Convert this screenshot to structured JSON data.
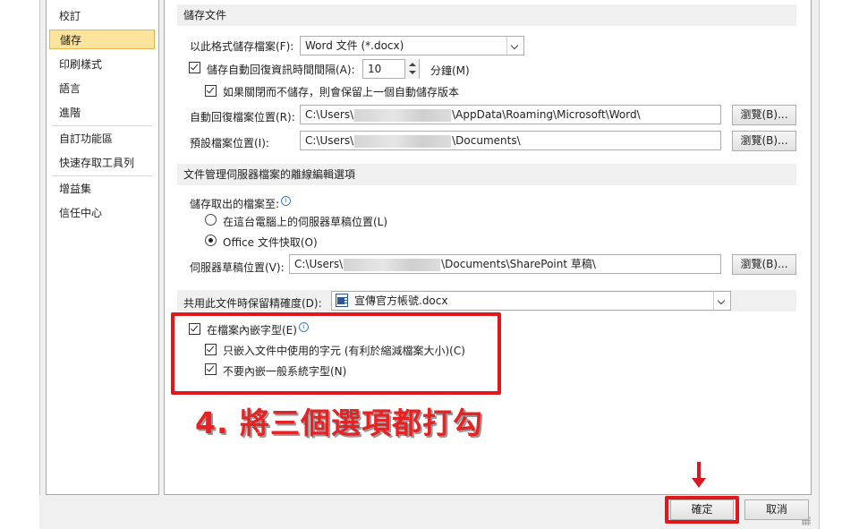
{
  "sidebar": {
    "items": [
      {
        "label": "校訂"
      },
      {
        "label": "儲存"
      },
      {
        "label": "印刷樣式"
      },
      {
        "label": "語言"
      },
      {
        "label": "進階"
      },
      {
        "label": "自訂功能區"
      },
      {
        "label": "快速存取工具列"
      },
      {
        "label": "增益集"
      },
      {
        "label": "信任中心"
      }
    ],
    "selected": "儲存"
  },
  "save_section": {
    "header": "儲存文件",
    "format_label": "以此格式儲存檔案(F):",
    "format_value": "Word 文件 (*.docx)",
    "autorecover_label": "儲存自動回復資訊時間間隔(A):",
    "autorecover_value": "10",
    "minutes_label": "分鐘(M)",
    "keep_last_label": "如果關閉而不儲存，則會保留上一個自動儲存版本",
    "autorecover_path_label": "自動回復檔案位置(R):",
    "autorecover_path_prefix": "C:\\Users\\",
    "autorecover_path_suffix": "\\AppData\\Roaming\\Microsoft\\Word\\",
    "default_path_label": "預設檔案位置(I):",
    "default_path_prefix": "C:\\Users\\",
    "default_path_suffix": "\\Documents\\",
    "browse_label": "瀏覽(B)..."
  },
  "server_section": {
    "header": "文件管理伺服器檔案的離線編輯選項",
    "save_checked_out_label": "儲存取出的檔案至:",
    "radio_server_drafts_label": "在這台電腦上的伺服器草稿位置(L)",
    "radio_office_cache_label": "Office 文件快取(O)",
    "drafts_path_label": "伺服器草稿位置(V):",
    "drafts_path_prefix": "C:\\Users\\",
    "drafts_path_suffix": "\\Documents\\SharePoint 草稿\\",
    "browse_label": "瀏覽(B)..."
  },
  "fidelity_section": {
    "header": "共用此文件時保留精確度(D):",
    "document_value": "宣傳官方帳號.docx",
    "embed_fonts_label": "在檔案內嵌字型(E)",
    "embed_used_chars_label": "只嵌入文件中使用的字元 (有利於縮減檔案大小)(C)",
    "no_common_fonts_label": "不要內嵌一般系統字型(N)"
  },
  "annotation": "4. 將三個選項都打勾",
  "buttons": {
    "ok": "確定",
    "cancel": "取消"
  },
  "colors": {
    "highlight": "#e0181c",
    "selected_nav": "#fce49c"
  }
}
